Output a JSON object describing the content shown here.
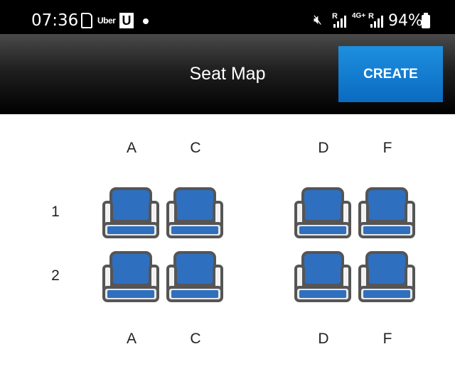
{
  "status_bar": {
    "time": "07:36",
    "sim_label": "SIM",
    "uber_label": "Uber",
    "u_badge": "U",
    "network": "4G+",
    "roaming_mark": "R",
    "battery": "94%"
  },
  "app_bar": {
    "title": "Seat Map",
    "create_label": "CREATE"
  },
  "seat_map": {
    "columns_top": [
      "A",
      "C",
      "D",
      "F"
    ],
    "columns_bottom": [
      "A",
      "C",
      "D",
      "F"
    ],
    "rows": [
      "1",
      "2"
    ],
    "seats": [
      {
        "row": "1",
        "col": "A"
      },
      {
        "row": "1",
        "col": "C"
      },
      {
        "row": "1",
        "col": "D"
      },
      {
        "row": "1",
        "col": "F"
      },
      {
        "row": "2",
        "col": "A"
      },
      {
        "row": "2",
        "col": "C"
      },
      {
        "row": "2",
        "col": "D"
      },
      {
        "row": "2",
        "col": "F"
      }
    ],
    "seat_color": "#2f6fbf",
    "seat_outline": "#555555"
  }
}
